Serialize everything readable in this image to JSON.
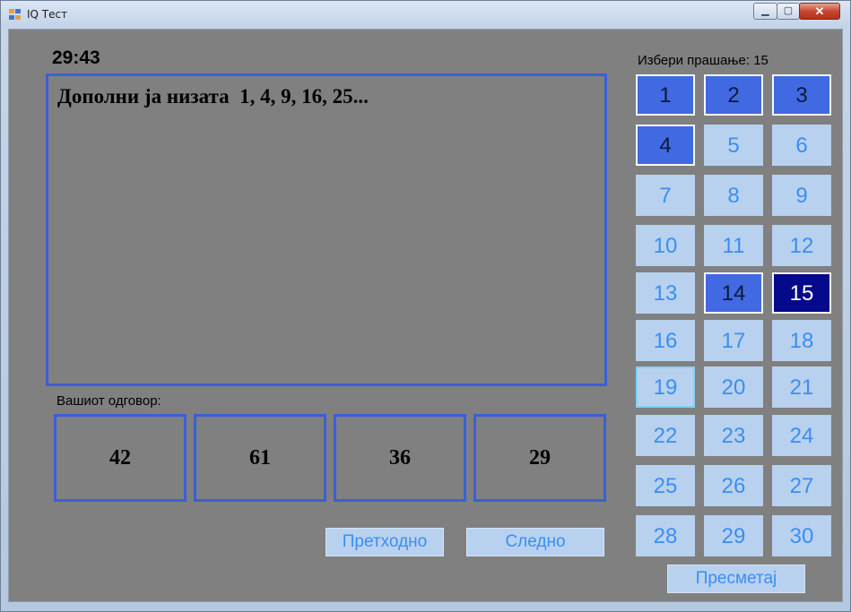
{
  "window": {
    "title": "IQ Тест"
  },
  "window_controls": {
    "minimize": "▁",
    "maximize": "▢",
    "close": "✕"
  },
  "timer": "29:43",
  "question": {
    "text": "Дополни ја низата  1, 4, 9, 16, 25..."
  },
  "answers": {
    "label": "Вашиот одговор:",
    "options": [
      "42",
      "61",
      "36",
      "29"
    ]
  },
  "nav": {
    "previous": "Претходно",
    "next": "Следно"
  },
  "selector": {
    "label": "Избери прашање: 15",
    "questions": [
      {
        "n": "1",
        "state": "answered"
      },
      {
        "n": "2",
        "state": "answered"
      },
      {
        "n": "3",
        "state": "answered"
      },
      {
        "n": "4",
        "state": "answered"
      },
      {
        "n": "5",
        "state": "unanswered"
      },
      {
        "n": "6",
        "state": "unanswered"
      },
      {
        "n": "7",
        "state": "unanswered"
      },
      {
        "n": "8",
        "state": "unanswered"
      },
      {
        "n": "9",
        "state": "unanswered"
      },
      {
        "n": "10",
        "state": "unanswered"
      },
      {
        "n": "11",
        "state": "unanswered"
      },
      {
        "n": "12",
        "state": "unanswered"
      },
      {
        "n": "13",
        "state": "unanswered"
      },
      {
        "n": "14",
        "state": "answered"
      },
      {
        "n": "15",
        "state": "current"
      },
      {
        "n": "16",
        "state": "unanswered"
      },
      {
        "n": "17",
        "state": "unanswered"
      },
      {
        "n": "18",
        "state": "unanswered"
      },
      {
        "n": "19",
        "state": "focused"
      },
      {
        "n": "20",
        "state": "unanswered"
      },
      {
        "n": "21",
        "state": "unanswered"
      },
      {
        "n": "22",
        "state": "unanswered"
      },
      {
        "n": "23",
        "state": "unanswered"
      },
      {
        "n": "24",
        "state": "unanswered"
      },
      {
        "n": "25",
        "state": "unanswered"
      },
      {
        "n": "26",
        "state": "unanswered"
      },
      {
        "n": "27",
        "state": "unanswered"
      },
      {
        "n": "28",
        "state": "unanswered"
      },
      {
        "n": "29",
        "state": "unanswered"
      },
      {
        "n": "30",
        "state": "unanswered"
      }
    ]
  },
  "calculate": "Пресметај",
  "colors": {
    "accent_border": "#3b5fd6",
    "answered": "#4169e1",
    "current": "#050a8c",
    "unanswered": "#b8d1ef",
    "button_text": "#3a8ff0"
  }
}
